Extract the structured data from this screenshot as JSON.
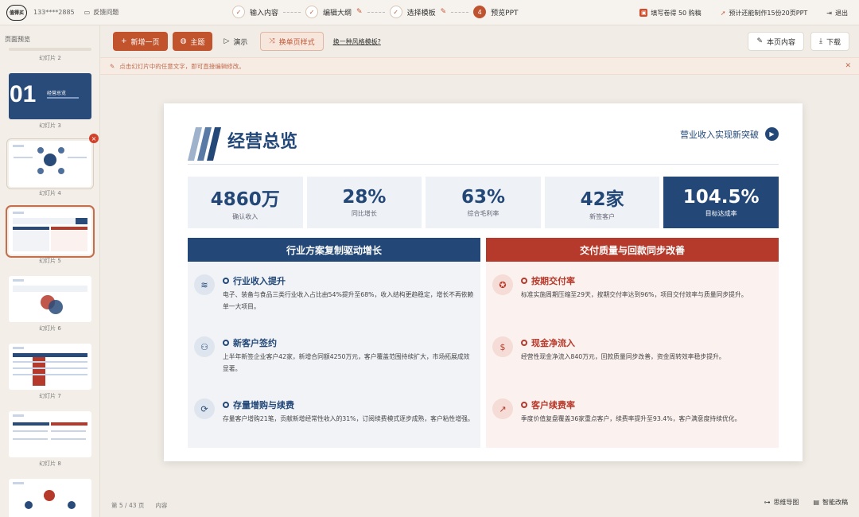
{
  "topbar": {
    "logo_text": "值得买",
    "phone": "133****2885",
    "feedback": "反馈问题",
    "steps": [
      {
        "label": "输入内容",
        "state": "done"
      },
      {
        "label": "编辑大纲",
        "state": "done"
      },
      {
        "label": "选择模板",
        "state": "done"
      },
      {
        "label": "预览PPT",
        "state": "active",
        "num": "4"
      }
    ],
    "promo": "填写卷得 50 购稿",
    "estimate": "预计还能制作15份20页PPT",
    "logout": "退出"
  },
  "sidebar": {
    "title": "页面预览",
    "slides": [
      {
        "label": "幻灯片 2"
      },
      {
        "label": "幻灯片 3",
        "big_text": "01",
        "small_text": "经营总览"
      },
      {
        "label": "幻灯片 4"
      },
      {
        "label": "幻灯片 5"
      },
      {
        "label": "幻灯片 6"
      },
      {
        "label": "幻灯片 7"
      },
      {
        "label": "幻灯片 8"
      }
    ]
  },
  "toolbar": {
    "add_page": "新增一页",
    "theme": "主题",
    "present": "演示",
    "change_style": "换单页样式",
    "change_template": "换一种风格模板?",
    "page_content": "本页内容",
    "download": "下载"
  },
  "notice": {
    "text": "点击幻灯片中的任意文字，即可直接编辑修改。"
  },
  "slide": {
    "title": "经营总览",
    "link": "营业收入实现新突破",
    "kpis": [
      {
        "value": "4860万",
        "label": "确认收入"
      },
      {
        "value": "28%",
        "label": "同比增长"
      },
      {
        "value": "63%",
        "label": "综合毛利率"
      },
      {
        "value": "42家",
        "label": "新签客户"
      },
      {
        "value": "104.5%",
        "label": "目标达成率"
      }
    ],
    "left": {
      "head": "行业方案复制驱动增长",
      "items": [
        {
          "title": "行业收入提升",
          "desc": "电子、装备与食品三类行业收入占比由54%提升至68%，收入结构更趋稳定，增长不再依赖单一大项目。"
        },
        {
          "title": "新客户签约",
          "desc": "上半年新签企业客户42家，新增合同额4250万元，客户覆盖范围持续扩大，市场拓展成效显著。"
        },
        {
          "title": "存量增购与续费",
          "desc": "存量客户增购21笔，贡献新增经常性收入的31%，订阅续费模式逐步成熟，客户粘性增强。"
        }
      ]
    },
    "right": {
      "head": "交付质量与回款同步改善",
      "items": [
        {
          "title": "按期交付率",
          "desc": "标准实施周期压缩至29天，按期交付率达到96%，项目交付效率与质量同步提升。"
        },
        {
          "title": "现金净流入",
          "desc": "经营性现金净流入840万元，回款质量同步改善，资金周转效率稳步提升。"
        },
        {
          "title": "客户续费率",
          "desc": "季度价值复盘覆盖36家重点客户，续费率提升至93.4%，客户满意度持续优化。"
        }
      ]
    }
  },
  "bottombar": {
    "page_info": "第 5 / 43 页",
    "label": "内容",
    "right1": "思维导图",
    "right2": "智能改稿"
  }
}
